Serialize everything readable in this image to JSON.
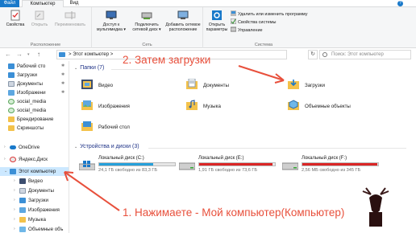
{
  "tabs": {
    "file": "Файл",
    "computer": "Компьютер",
    "view": "Вид",
    "help": "?"
  },
  "ribbon": {
    "location": {
      "label": "Расположение",
      "properties": "Свойства",
      "open": "Открыть",
      "rename": "Переименовать"
    },
    "network": {
      "label": "Сеть",
      "media_access": [
        "Доступ к",
        "мультимедиа ▾"
      ],
      "map_drive": [
        "Подключить",
        "сетевой диск ▾"
      ],
      "add_location": [
        "Добавить сетевое",
        "расположение"
      ]
    },
    "system": {
      "label": "Система",
      "open_settings": [
        "Открыть",
        "параметры"
      ],
      "uninstall": "Удалить или изменить программу",
      "system_props": "Свойства системы",
      "manage": "Управление"
    }
  },
  "address": {
    "back": "←",
    "forward": "→",
    "up": "↑",
    "path": "Этот компьютер",
    "path_sep": ">",
    "refresh": "↻",
    "search_placeholder": "Поиск: Этот компьютер"
  },
  "sidebar": {
    "quick": [
      {
        "label": "Рабочий сто",
        "pinned": true
      },
      {
        "label": "Загрузки",
        "pinned": true
      },
      {
        "label": "Документы",
        "pinned": true
      },
      {
        "label": "Изображени",
        "pinned": true
      },
      {
        "label": "social_media",
        "pinned": false
      },
      {
        "label": "social_media",
        "pinned": false
      },
      {
        "label": "Брендирование",
        "pinned": false
      },
      {
        "label": "Скриншоты",
        "pinned": false
      }
    ],
    "onedrive": "OneDrive",
    "yandex": "Яндекс.Диск",
    "this_pc": "Этот компьютер",
    "pc_children": [
      "Видео",
      "Документы",
      "Загрузки",
      "Изображения",
      "Музыка",
      "Объемные объ"
    ]
  },
  "folders": {
    "header": "Папки (7)",
    "items": [
      "Видео",
      "Документы",
      "Загрузки",
      "Изображения",
      "Музыка",
      "Объемные объекты",
      "Рабочий стол"
    ]
  },
  "drives": {
    "header": "Устройства и диски (3)",
    "items": [
      {
        "name": "Локальный диск (C:)",
        "free": "24,1 ГБ свободно из 83,3 ГБ",
        "used_fraction": 0.71
      },
      {
        "name": "Локальный диск (E:)",
        "free": "1,91 ГБ свободно из 73,6 ГБ",
        "used_fraction": 0.97
      },
      {
        "name": "Локальный диск (F:)",
        "free": "2,56 МБ свободно из 345 ГБ",
        "used_fraction": 0.99
      }
    ]
  },
  "annotations": {
    "step2": "2. Затем загрузки",
    "step1": "1. Нажимаете - Мой компьютер(Компьютер)"
  },
  "colors": {
    "accent": "#1979ca",
    "folder": "#f3c24b",
    "annotation": "#e8503c",
    "drive_full": "#da2626",
    "selection": "#cce8ff"
  }
}
